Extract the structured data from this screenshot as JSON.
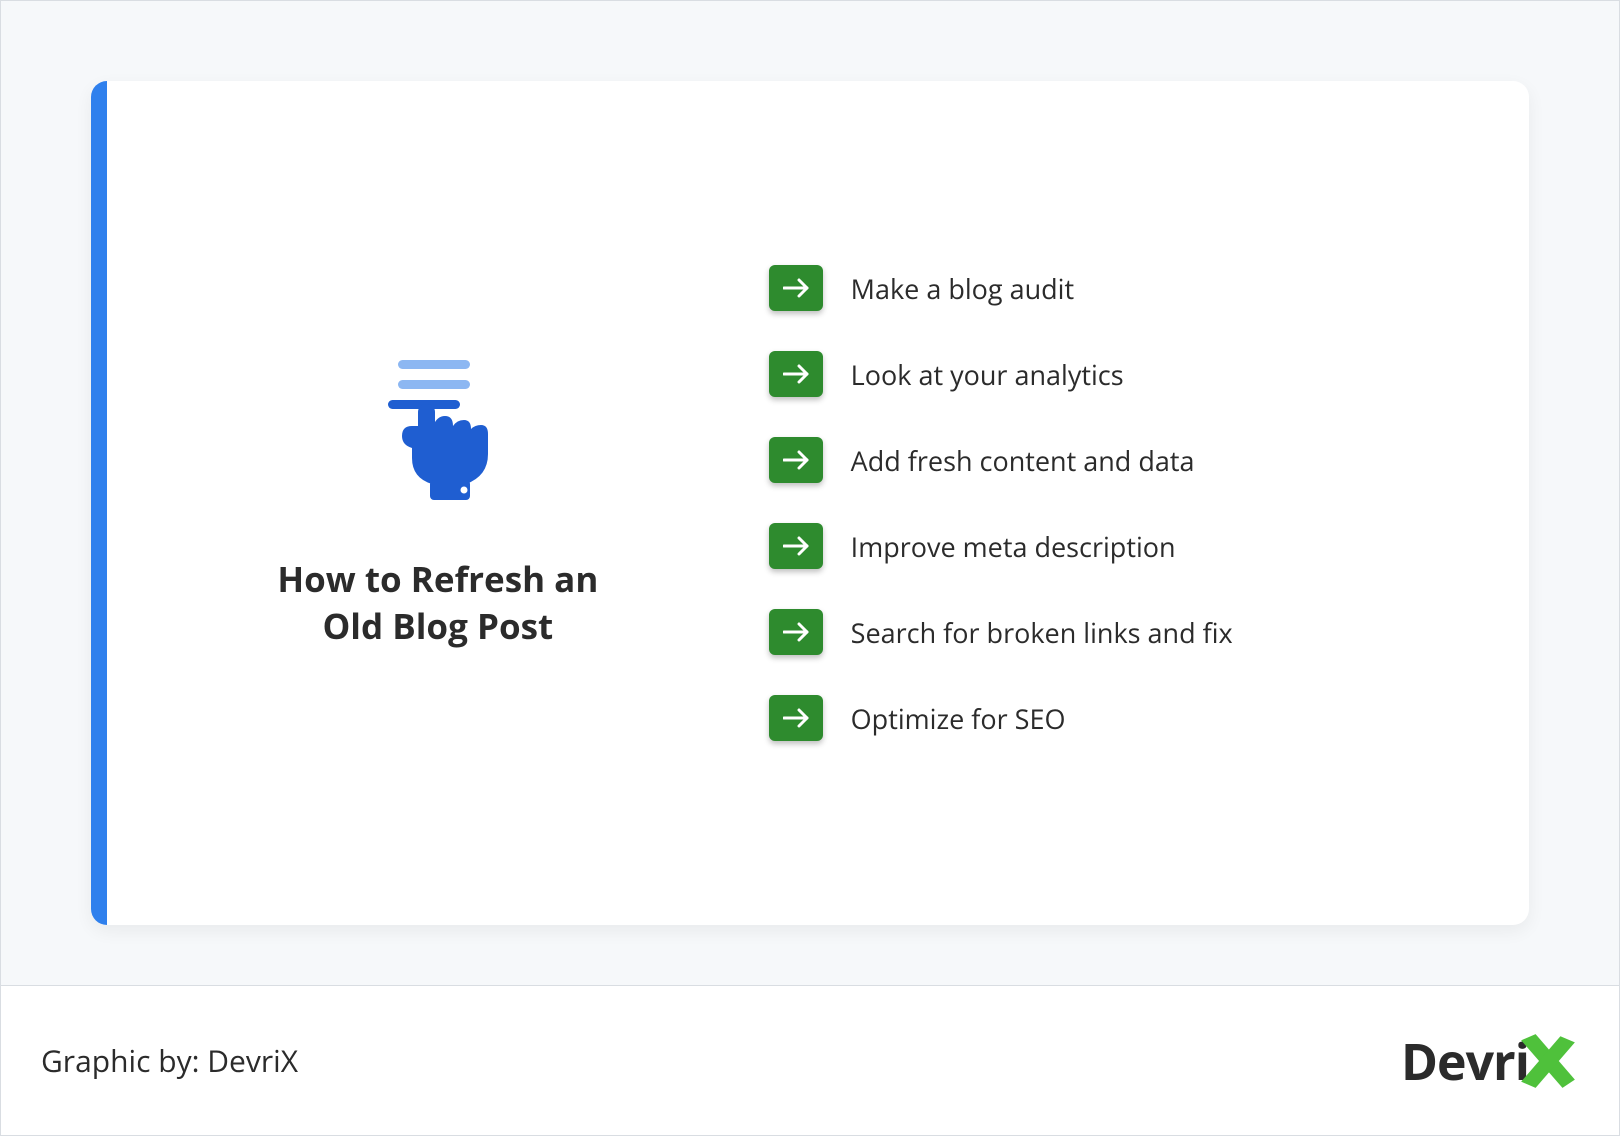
{
  "title": "How to Refresh an Old Blog Post",
  "items": [
    "Make a blog audit",
    "Look at your analytics",
    "Add fresh content and data",
    "Improve meta description",
    "Search for broken links and fix",
    "Optimize for SEO"
  ],
  "credit": "Graphic by: DevriX",
  "brand_prefix": "Devri",
  "colors": {
    "accent_blue": "#2f80ed",
    "arrow_green": "#2e8b2e",
    "brand_green": "#4fc13b",
    "icon_blue_dark": "#1f5ed1",
    "icon_blue_light": "#8cb7f2"
  }
}
